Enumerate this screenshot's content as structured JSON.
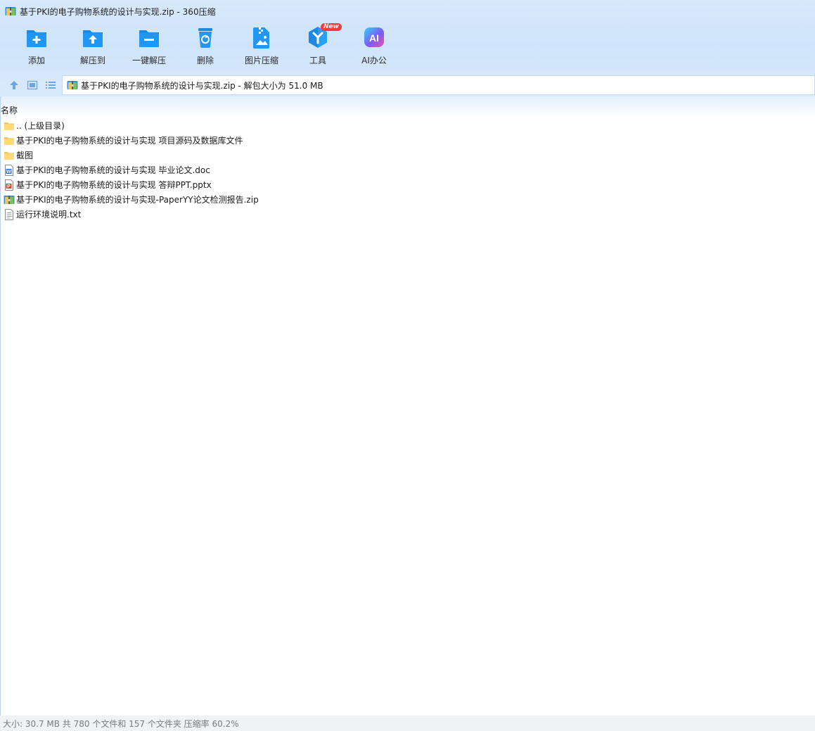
{
  "window": {
    "title": "基于PKI的电子购物系统的设计与实现.zip - 360压缩"
  },
  "toolbar": {
    "items": [
      {
        "label": "添加",
        "icon": "add-folder-icon"
      },
      {
        "label": "解压到",
        "icon": "extract-to-icon"
      },
      {
        "label": "一键解压",
        "icon": "one-click-extract-icon"
      },
      {
        "label": "删除",
        "icon": "recycle-bin-icon"
      },
      {
        "label": "图片压缩",
        "icon": "image-compress-icon"
      },
      {
        "label": "工具",
        "icon": "tools-icon",
        "badge": "New"
      },
      {
        "label": "AI办公",
        "icon": "ai-office-icon"
      }
    ]
  },
  "address": {
    "text": "基于PKI的电子购物系统的设计与实现.zip - 解包大小为 51.0 MB"
  },
  "list": {
    "column_name": "名称",
    "rows": [
      {
        "name": ".. (上级目录)",
        "type": "folder"
      },
      {
        "name": "基于PKI的电子购物系统的设计与实现 项目源码及数据库文件",
        "type": "folder"
      },
      {
        "name": "截图",
        "type": "folder"
      },
      {
        "name": "基于PKI的电子购物系统的设计与实现 毕业论文.doc",
        "type": "word"
      },
      {
        "name": "基于PKI的电子购物系统的设计与实现 答辩PPT.pptx",
        "type": "ppt"
      },
      {
        "name": "基于PKI的电子购物系统的设计与实现-PaperYY论文检测报告.zip",
        "type": "zip"
      },
      {
        "name": "运行环境说明.txt",
        "type": "txt"
      }
    ]
  },
  "status": {
    "text": "大小: 30.7 MB 共 780 个文件和 157 个文件夹 压缩率 60.2%"
  },
  "colors": {
    "accent": "#1e88e5",
    "toolbar_bg": "#d4e7fb",
    "status_text": "#7a7a7a"
  }
}
